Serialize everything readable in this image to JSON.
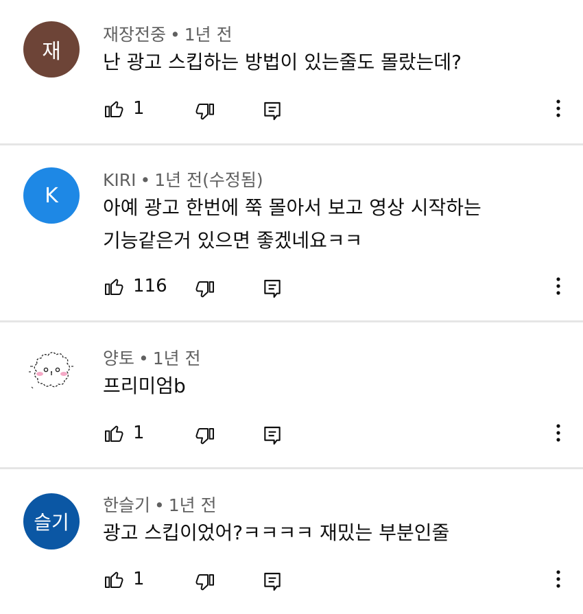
{
  "comments": [
    {
      "avatar_text": "재",
      "avatar_color": "#6d4437",
      "author": "재장전중",
      "time": "1년 전",
      "lines": [
        "난 광고 스킵하는 방법이 있는줄도 몰랐는데?"
      ],
      "likes": "1"
    },
    {
      "avatar_text": "K",
      "avatar_color": "#1e88e5",
      "author": "KIRI",
      "time": "1년 전(수정됨)",
      "lines": [
        "아예 광고 한번에 쭉 몰아서 보고 영상 시작하는",
        "기능같은거 있으면 좋겠네요ㅋㅋ"
      ],
      "likes": "116"
    },
    {
      "avatar_text": "",
      "avatar_color": "#ffffff",
      "author": "양토",
      "time": "1년 전",
      "lines": [
        "프리미엄b"
      ],
      "likes": "1"
    },
    {
      "avatar_text": "슬기",
      "avatar_color": "#0b57a4",
      "author": "한슬기",
      "time": "1년 전",
      "lines": [
        "광고 스킵이었어?ㅋㅋㅋㅋ 재밌는 부분인줄"
      ],
      "likes": "1"
    }
  ],
  "meta_separator": "•",
  "icons": {
    "like": "thumb-up-outline-icon",
    "dislike": "thumb-down-outline-icon",
    "reply": "reply-comment-icon",
    "more": "more-vert-icon"
  }
}
